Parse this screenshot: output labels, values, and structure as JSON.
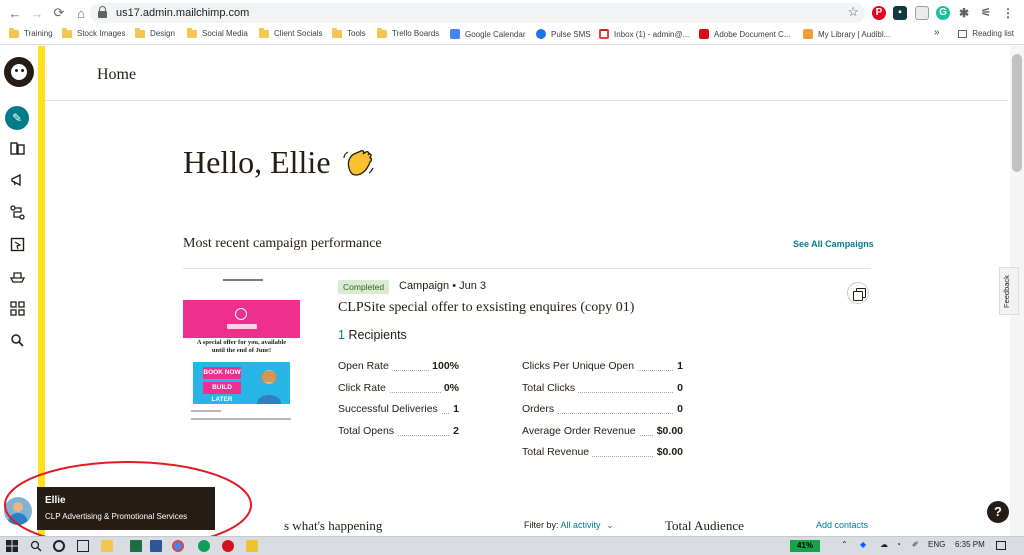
{
  "browser": {
    "url": "us17.admin.mailchimp.com",
    "bookmarks": [
      "Training",
      "Stock Images",
      "Design",
      "Social Media",
      "Client Socials",
      "Tools",
      "Trello Boards",
      "Google Calendar",
      "Pulse SMS",
      "Inbox (1) - admin@...",
      "Adobe Document C...",
      "My Library | Audibl..."
    ],
    "reading_list": "Reading list",
    "more": "»"
  },
  "page": {
    "title": "Home",
    "greeting": "Hello, Ellie",
    "section_title": "Most recent campaign performance",
    "see_all": "See All Campaigns"
  },
  "campaign": {
    "status": "Completed",
    "meta": "Campaign • Jun 3",
    "name": "CLPSite special offer to exsisting enquires (copy 01)",
    "recipients_count": "1",
    "recipients_label": "Recipients",
    "thumb": {
      "offer_line1": "A special offer for you, available",
      "offer_line2": "until the end of June!",
      "book_now": "BOOK NOW",
      "build_later": "BUILD LATER"
    },
    "stats_left": [
      {
        "label": "Open Rate",
        "value": "100%"
      },
      {
        "label": "Click Rate",
        "value": "0%"
      },
      {
        "label": "Successful Deliveries",
        "value": "1"
      },
      {
        "label": "Total Opens",
        "value": "2"
      }
    ],
    "stats_right": [
      {
        "label": "Clicks Per Unique Open",
        "value": "1"
      },
      {
        "label": "Total Clicks",
        "value": "0"
      },
      {
        "label": "Orders",
        "value": "0"
      },
      {
        "label": "Average Order Revenue",
        "value": "$0.00"
      },
      {
        "label": "Total Revenue",
        "value": "$0.00"
      }
    ]
  },
  "bottom": {
    "happening": "s what's happening",
    "filter_label": "Filter by:",
    "filter_value": "All activity",
    "audience_title": "Total Audience",
    "add_contacts": "Add contacts"
  },
  "feedback": "Feedback",
  "help": "?",
  "user": {
    "name": "Ellie",
    "org": "CLP Advertising & Promotional Services"
  },
  "taskbar": {
    "battery": "41%",
    "lang": "ENG",
    "time": "6:35 PM"
  },
  "colors": {
    "brand_yellow": "#ffe01b",
    "teal": "#007c89",
    "annotation_red": "#e01b24"
  }
}
